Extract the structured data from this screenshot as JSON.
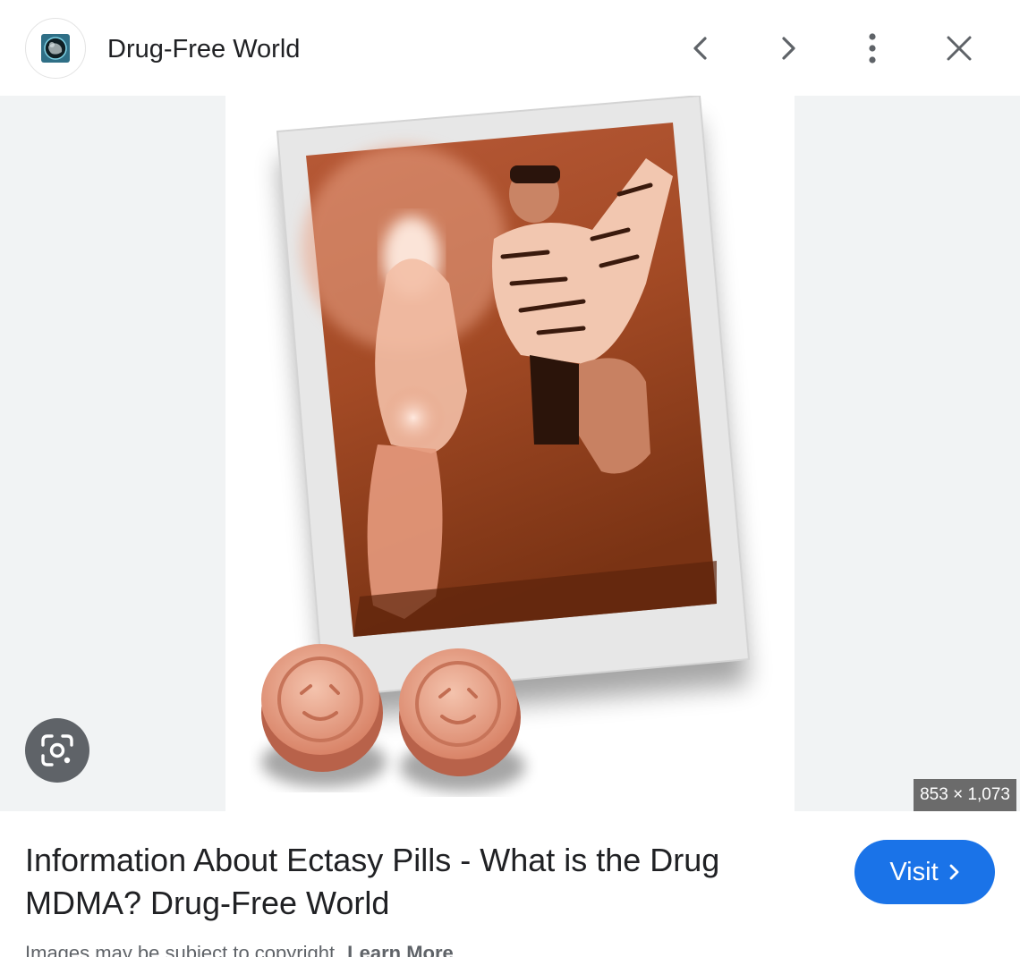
{
  "header": {
    "source_name": "Drug-Free World",
    "favicon_icon": "drug-free-world-globe-icon",
    "prev_icon": "chevron-left-icon",
    "next_icon": "chevron-right-icon",
    "more_icon": "more-vert-icon",
    "close_icon": "close-icon"
  },
  "image": {
    "dimensions": "853 × 1,073",
    "lens_icon": "google-lens-icon"
  },
  "result": {
    "title": "Information About Ectasy Pills - What is the Drug MDMA? Drug-Free World",
    "visit_label": "Visit",
    "visit_icon": "chevron-right-icon",
    "copyright_text": "Images may be subject to copyright.",
    "learn_more_label": "Learn More"
  },
  "colors": {
    "accent": "#1a73e8",
    "stage_background": "#f1f3f4",
    "text": "#202124",
    "secondary_text": "#5f6368"
  }
}
